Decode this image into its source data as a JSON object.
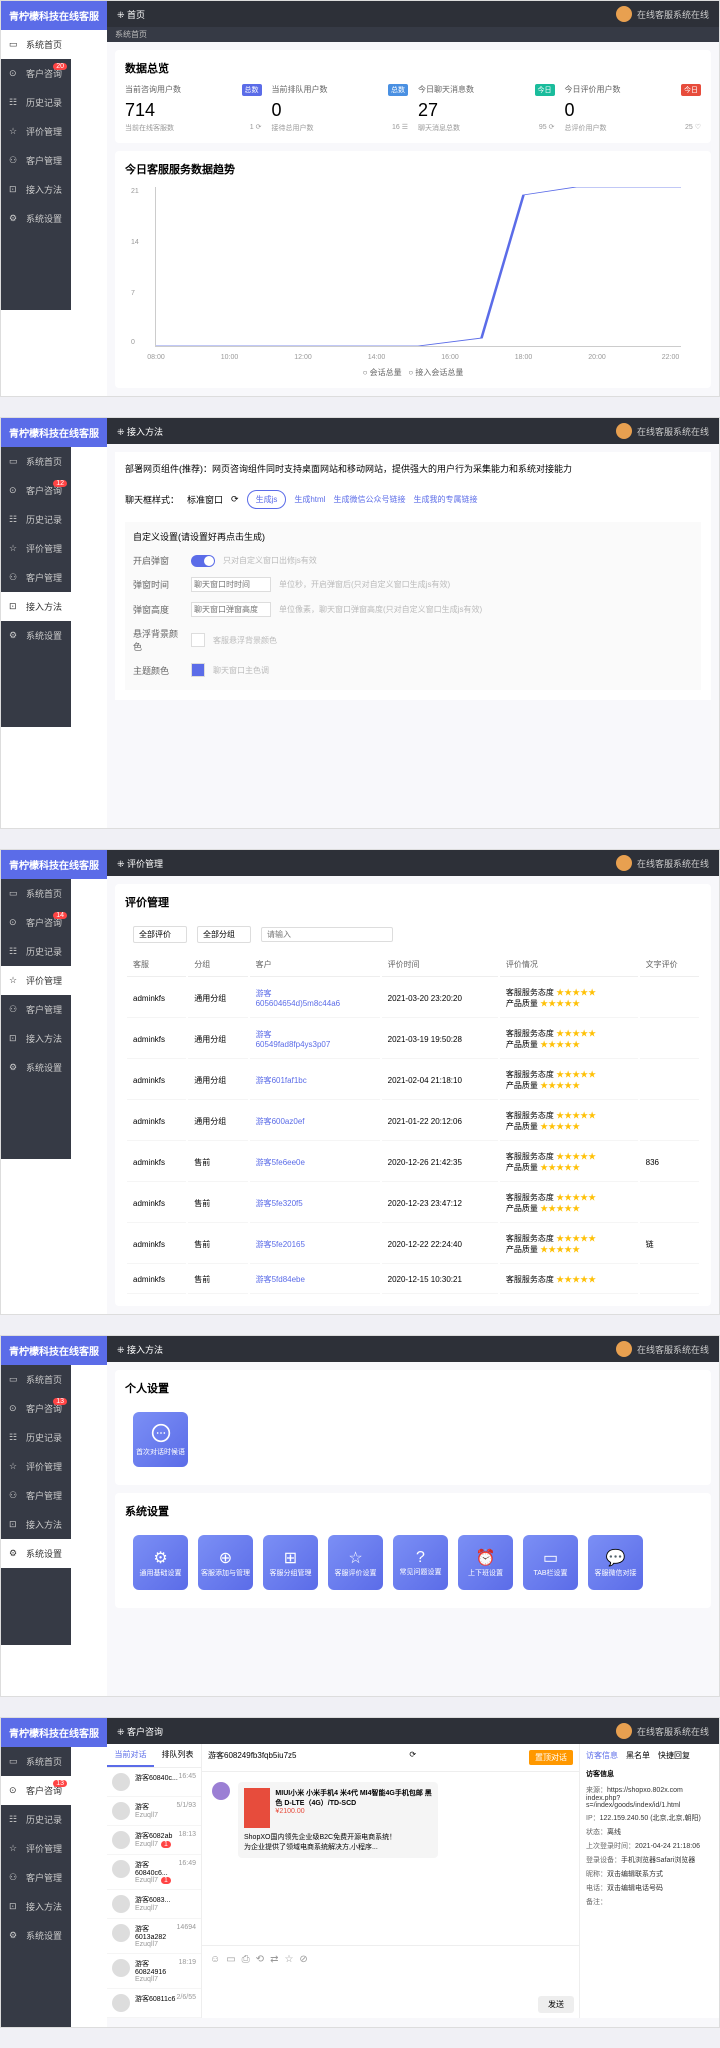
{
  "brand": "青柠檬科技在线客服",
  "header_status": "在线客服系统在线",
  "sidebar": {
    "items": [
      {
        "label": "系统首页"
      },
      {
        "label": "客户咨询",
        "badge": "20"
      },
      {
        "label": "历史记录"
      },
      {
        "label": "评价管理"
      },
      {
        "label": "客户管理"
      },
      {
        "label": "接入方法"
      },
      {
        "label": "系统设置"
      }
    ]
  },
  "s1": {
    "breadcrumb": "首页",
    "tab": "系统首页",
    "overview_title": "数据总览",
    "stats": [
      {
        "label": "当前咨询用户数",
        "tag": "总数",
        "value": "714",
        "sub": "当前在线客服数",
        "subval": "1 ⟳"
      },
      {
        "label": "当前排队用户数",
        "tag": "总数",
        "value": "0",
        "sub": "接待总用户数",
        "subval": "16 ☰"
      },
      {
        "label": "今日聊天消息数",
        "tag": "今日",
        "value": "27",
        "sub": "聊天消息总数",
        "subval": "95 ⟳"
      },
      {
        "label": "今日评价用户数",
        "tag": "今日",
        "value": "0",
        "sub": "总评价用户数",
        "subval": "25 ♡"
      }
    ],
    "chart_title": "今日客服服务数据趋势",
    "legend1": "会话总量",
    "legend2": "接入会话总量"
  },
  "chart_data": {
    "type": "line",
    "x": [
      "08:00",
      "10:00",
      "12:00",
      "14:00",
      "16:00",
      "18:00",
      "20:00",
      "22:00"
    ],
    "series": [
      {
        "name": "会话总量",
        "values": [
          0,
          0,
          0,
          0,
          0,
          2,
          20,
          21,
          21,
          21
        ]
      }
    ],
    "ylim": [
      0,
      21
    ],
    "y_ticks": [
      0,
      7,
      14,
      21
    ]
  },
  "s2": {
    "breadcrumb": "接入方法",
    "desc": "部署网页组件(推荐)：网页咨询组件同时支持桌面网站和移动网站，提供强大的用户行为采集能力和系统对接能力",
    "mode_label": "聊天框样式：",
    "mode_text": "标准窗口",
    "btn1": "生成js",
    "btn2": "生成html",
    "btn3": "生成微信公众号链接",
    "btn4": "生成我的专属链接",
    "custom_title": "自定义设置(请设置好再点击生成)",
    "rows": [
      {
        "label": "开启弹窗",
        "hint": "只对自定义窗口出修js有效"
      },
      {
        "label": "弹窗时间",
        "placeholder": "聊天窗口时时间",
        "hint": "单位秒，开启弹窗后(只对自定义窗口生成js有效)"
      },
      {
        "label": "弹窗高度",
        "placeholder": "聊天窗口弹窗高度",
        "hint": "单位像素，聊天窗口弹窗高度(只对自定义窗口生成js有效)"
      },
      {
        "label": "悬浮背景颜色",
        "hint": "客服悬浮背景颜色"
      },
      {
        "label": "主题颜色",
        "hint": "聊天窗口主色调"
      }
    ]
  },
  "s3": {
    "breadcrumb": "评价管理",
    "title": "评价管理",
    "filter_all": "全部评价",
    "filter_group": "全部分组",
    "filter_input": "请输入",
    "cols": [
      "客服",
      "分组",
      "客户",
      "评价时间",
      "评价情况",
      "文字评价"
    ],
    "rows": [
      {
        "a": "adminkfs",
        "g": "通用分组",
        "c": "游客\n605604654d)5m8c44a6",
        "t": "2021-03-20 23:20:20",
        "r": "客服服务态度 ★★★★★\n产品质量 ★★★★★",
        "txt": ""
      },
      {
        "a": "adminkfs",
        "g": "通用分组",
        "c": "游客\n60549fad8fp4ys3p07",
        "t": "2021-03-19 19:50:28",
        "r": "客服服务态度 ★★★★★\n产品质量 ★★★★★",
        "txt": ""
      },
      {
        "a": "adminkfs",
        "g": "通用分组",
        "c": "游客601faf1bc",
        "t": "2021-02-04 21:18:10",
        "r": "客服服务态度 ★★★★★\n产品质量 ★★★★★",
        "txt": ""
      },
      {
        "a": "adminkfs",
        "g": "通用分组",
        "c": "游客600az0ef",
        "t": "2021-01-22 20:12:06",
        "r": "客服服务态度 ★★★★★\n产品质量 ★★★★★",
        "txt": ""
      },
      {
        "a": "adminkfs",
        "g": "售前",
        "c": "游客5fe6ee0e",
        "t": "2020-12-26 21:42:35",
        "r": "客服服务态度 ★★★★★\n产品质量 ★★★★★",
        "txt": "836"
      },
      {
        "a": "adminkfs",
        "g": "售前",
        "c": "游客5fe320f5",
        "t": "2020-12-23 23:47:12",
        "r": "客服服务态度 ★★★★★\n产品质量 ★★★★★",
        "txt": ""
      },
      {
        "a": "adminkfs",
        "g": "售前",
        "c": "游客5fe20165",
        "t": "2020-12-22 22:24:40",
        "r": "客服服务态度 ★★★★★\n产品质量 ★★★★★",
        "txt": "链"
      },
      {
        "a": "adminkfs",
        "g": "售前",
        "c": "游客5fd84ebe",
        "t": "2020-12-15 10:30:21",
        "r": "客服服务态度 ★★★★★\n",
        "txt": ""
      }
    ]
  },
  "s4": {
    "breadcrumb": "接入方法",
    "personal_title": "个人设置",
    "personal_card": "首次对话时候语",
    "system_title": "系统设置",
    "cards": [
      "通用基础设置",
      "客服添加与管理",
      "客服分组管理",
      "客服评价设置",
      "常见问题设置",
      "上下班设置",
      "TAB栏设置",
      "客服微信对接"
    ]
  },
  "s5": {
    "breadcrumb": "客户咨询",
    "badge": "13",
    "tabs": [
      "当前对话",
      "排队列表"
    ],
    "list": [
      {
        "name": "游客60840c...",
        "time": "16:45",
        "sub": "",
        "badge": ""
      },
      {
        "name": "游客",
        "time": "5/1/93",
        "sub": "Ezuqll7"
      },
      {
        "name": "游客6082ab",
        "time": "18:13",
        "sub": "Ezuqll7",
        "badge": "1"
      },
      {
        "name": "游客60840c6...",
        "time": "16:49",
        "sub": "Ezuqll7",
        "badge": "1"
      },
      {
        "name": "游客6083...",
        "time": "",
        "sub": "Ezuqll7"
      },
      {
        "name": "游客6013a282",
        "time": "14694",
        "sub": "Ezuqll7"
      },
      {
        "name": "游客60824916",
        "time": "18:19",
        "sub": "Ezuqll7"
      },
      {
        "name": "游客60811c6",
        "time": "2/6/55",
        "sub": ""
      }
    ],
    "chat_user": "游客608249fb3fqb5iu7z5",
    "btn_fire": "置顶对话",
    "msg_title": "MIUI小米 小米手机4 米4代 MI4智能4G手机包邮 黑色 D-LTE（4G）/TD-SCD",
    "msg_price": "¥2100.00",
    "msg_desc": "ShopXO国内领先企业级B2C免费开源电商系统！\n为企业提供了领域电商系统解决方,小程序...",
    "send": "发送",
    "info_tabs": [
      "访客信息",
      "黑名单",
      "快捷回复"
    ],
    "info_title": "访客信息",
    "info": [
      {
        "k": "来源：",
        "v": "https://shopxo.802x.com\nindex.php?s=/index/goods/index/id/1.html"
      },
      {
        "k": "IP：",
        "v": "122.159.240.50 (北京,北京,朝阳)"
      },
      {
        "k": "状态：",
        "v": "离线"
      },
      {
        "k": "上次登录时间：",
        "v": "2021-04-24 21:18:06"
      },
      {
        "k": "登录设备：",
        "v": "手机浏览器Safari浏览器"
      },
      {
        "k": "昵称：",
        "v": "双击编辑联系方式"
      },
      {
        "k": "电话：",
        "v": "双击编辑电话号码"
      },
      {
        "k": "备注：",
        "v": ""
      }
    ]
  }
}
